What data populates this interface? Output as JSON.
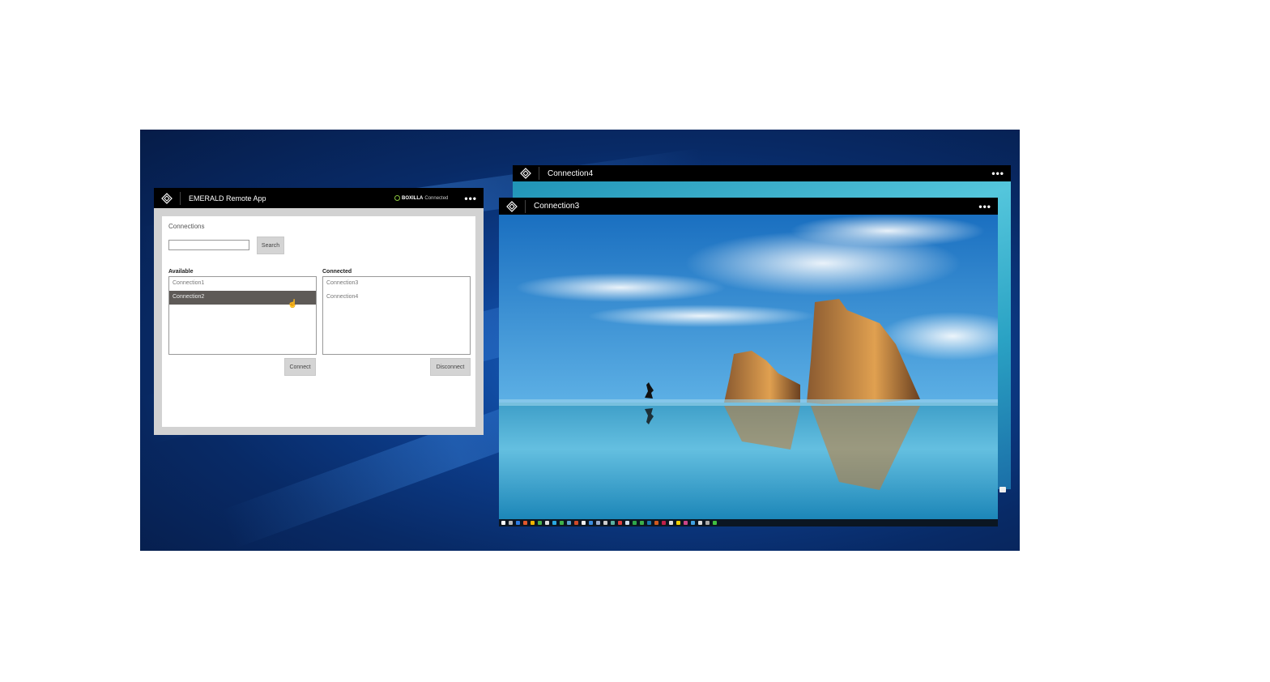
{
  "app": {
    "title": "EMERALD Remote App",
    "status_brand": "BOXILLA",
    "status_text": "Connected",
    "status_color": "#8cc63f",
    "menu_icon": "more-dots-icon",
    "section_title": "Connections",
    "search_placeholder": "",
    "search_value": "",
    "search_label": "Search",
    "available_label": "Available",
    "available": [
      "Connection1",
      "Connection2"
    ],
    "selected_available": "Connection2",
    "connected_label": "Connected",
    "connected": [
      "Connection3",
      "Connection4"
    ],
    "connect_label": "Connect",
    "disconnect_label": "Disconnect"
  },
  "windows": [
    {
      "title": "Connection4"
    },
    {
      "title": "Connection3"
    }
  ],
  "taskbar_colors": [
    "#ffffff",
    "#bbbbbb",
    "#2a7be4",
    "#e2572b",
    "#f0b400",
    "#47b04b",
    "#dddddd",
    "#2aa8e0",
    "#3fb24a",
    "#5aa0d0",
    "#d04a2a",
    "#eeeeee",
    "#3a8de0",
    "#99aacc",
    "#cccccc",
    "#5bb0a0",
    "#e04040",
    "#ccddee",
    "#2ea84a",
    "#3cb04a",
    "#1a7ab0",
    "#d05a20",
    "#c0204a",
    "#dddddd",
    "#f0d000",
    "#cc4488",
    "#40a0e0",
    "#dddddd",
    "#aaaaaa",
    "#40c040"
  ]
}
